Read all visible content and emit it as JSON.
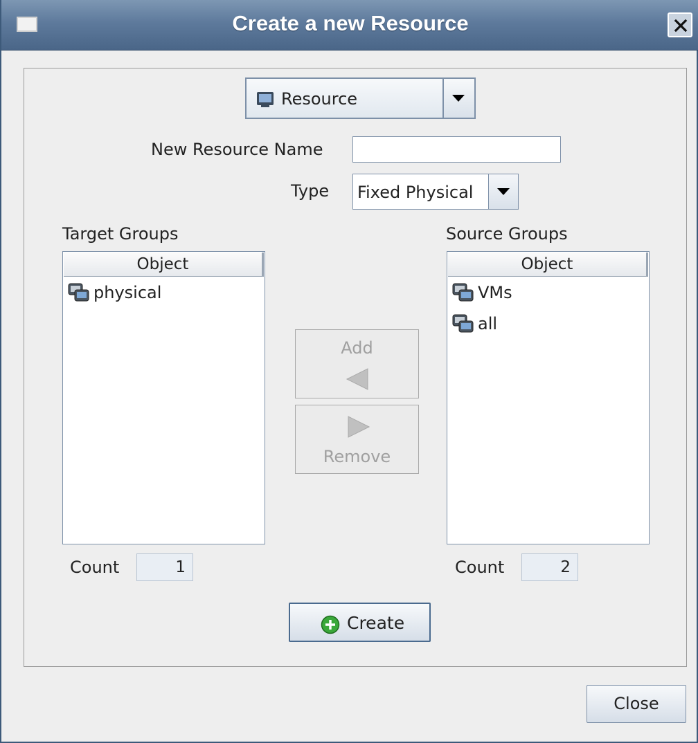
{
  "window": {
    "title": "Create a new Resource"
  },
  "resource_selector": {
    "selected": "Resource",
    "icon": "monitor-icon"
  },
  "form": {
    "name_label": "New Resource Name",
    "name_value": "",
    "type_label": "Type",
    "type_selected": "Fixed Physical"
  },
  "target_groups": {
    "title": "Target Groups",
    "column": "Object",
    "items": [
      {
        "label": "physical",
        "icon": "group-icon"
      }
    ],
    "count_label": "Count",
    "count": "1"
  },
  "source_groups": {
    "title": "Source Groups",
    "column": "Object",
    "items": [
      {
        "label": "VMs",
        "icon": "group-icon"
      },
      {
        "label": "all",
        "icon": "group-icon"
      }
    ],
    "count_label": "Count",
    "count": "2"
  },
  "actions": {
    "add_label": "Add",
    "remove_label": "Remove",
    "create_label": "Create",
    "close_label": "Close"
  }
}
